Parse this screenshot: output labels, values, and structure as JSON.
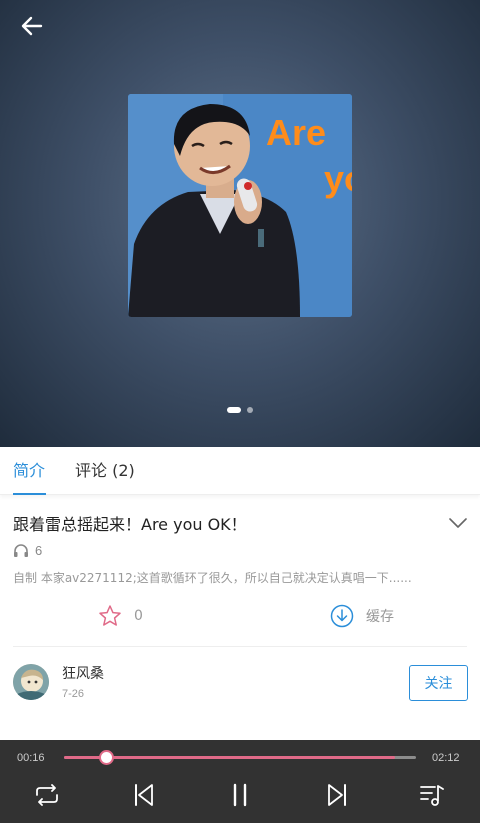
{
  "hero": {
    "cover_text_line1": "Are",
    "cover_text_line2": "yo",
    "pages": 2,
    "active_page": 1
  },
  "tabs": [
    {
      "label": "简介",
      "active": true
    },
    {
      "label": "评论 (2)",
      "active": false
    }
  ],
  "song": {
    "title": "跟着雷总摇起来！Are you OK！",
    "plays": "6",
    "description": "自制 本家av2271112;这首歌循环了很久，所以自己就决定认真唱一下......"
  },
  "actions": {
    "like_count": "0",
    "cache_label": "缓存"
  },
  "author": {
    "name": "狂风桑",
    "date": "7-26",
    "follow_label": "关注"
  },
  "player": {
    "current_time": "00:16",
    "total_time": "02:12",
    "progress": 0.12,
    "buffered": 0.94
  },
  "colors": {
    "accent": "#2b8ed9",
    "progress": "#e06a88",
    "player_bg": "#323232",
    "like_icon": "#e06a88"
  },
  "icons": {
    "back": "arrow-left-icon",
    "expand": "chevron-down-icon",
    "plays": "headphones-icon",
    "like": "star-icon",
    "cache": "download-icon",
    "repeat": "repeat-icon",
    "previous": "skip-previous-icon",
    "pause": "pause-icon",
    "next": "skip-next-icon",
    "playlist": "playlist-icon"
  }
}
